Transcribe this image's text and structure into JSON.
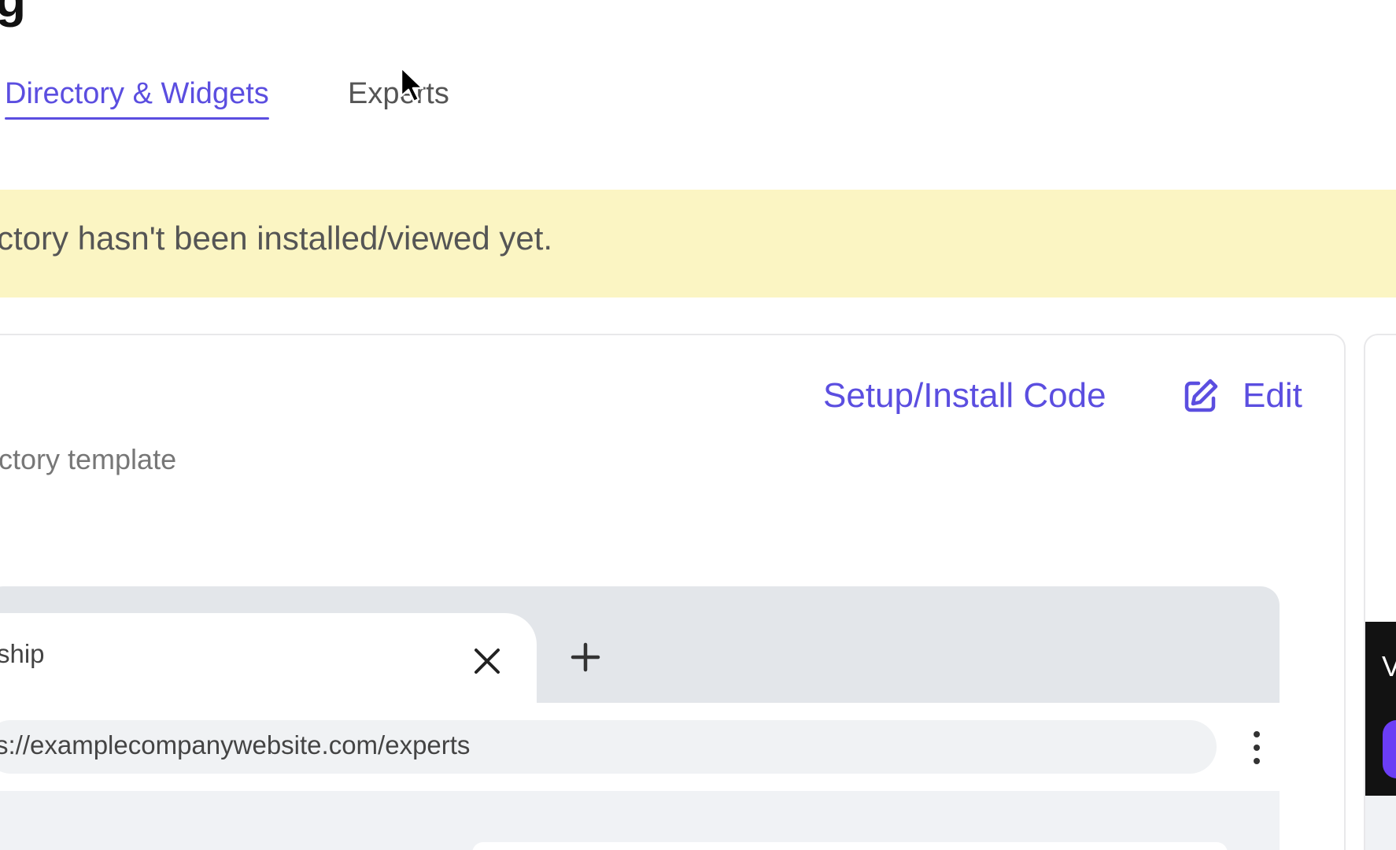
{
  "header": {
    "title_fragment": "g"
  },
  "tabs": [
    {
      "label": "Directory & Widgets",
      "active": true
    },
    {
      "label": "Experts",
      "active": false
    }
  ],
  "banner": {
    "text": "ctory hasn't been installed/viewed yet.",
    "background": "#fbf5c3"
  },
  "card": {
    "setup_label": "Setup/Install Code",
    "edit_label": "Edit",
    "subtext": "ctory template"
  },
  "browser_mock": {
    "tab_title": "ship",
    "url": "s://examplecompanywebsite.com/experts"
  },
  "side_panel": {
    "letter": "V"
  },
  "colors": {
    "accent": "#5b4ee0",
    "banner": "#fbf5c3",
    "browser_chrome": "#e3e6ea"
  },
  "icons": [
    "edit-icon",
    "close-icon",
    "plus-icon",
    "kebab-menu-icon",
    "mouse-cursor-icon"
  ]
}
